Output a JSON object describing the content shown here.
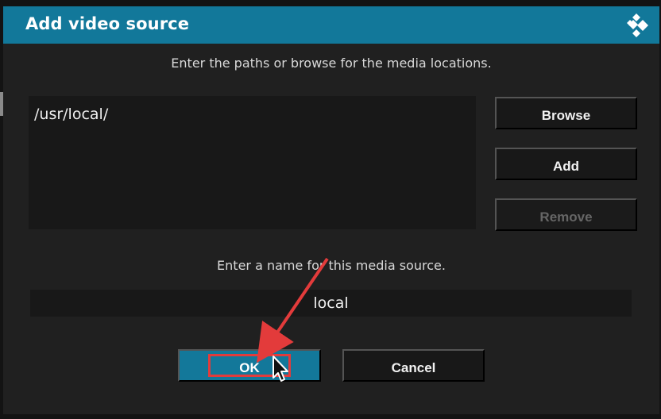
{
  "window": {
    "title": "Add video source"
  },
  "icons": {
    "logo": "kodi-logo-icon",
    "pointer": "mouse-cursor-icon",
    "annotation": "red-arrow-icon"
  },
  "paths": {
    "instruction": "Enter the paths or browse for the media locations.",
    "items": [
      "/usr/local/"
    ]
  },
  "actions": {
    "browse_label": "Browse",
    "add_label": "Add",
    "remove_label": "Remove"
  },
  "source_name": {
    "instruction": "Enter a name for this media source.",
    "value": "local"
  },
  "footer": {
    "ok_label": "OK",
    "cancel_label": "Cancel"
  },
  "colors": {
    "titlebar": "#12789a",
    "dialog_background": "#202020",
    "control_background": "#181818",
    "focused_button": "#13789a",
    "annotation": "#e33b3b"
  }
}
